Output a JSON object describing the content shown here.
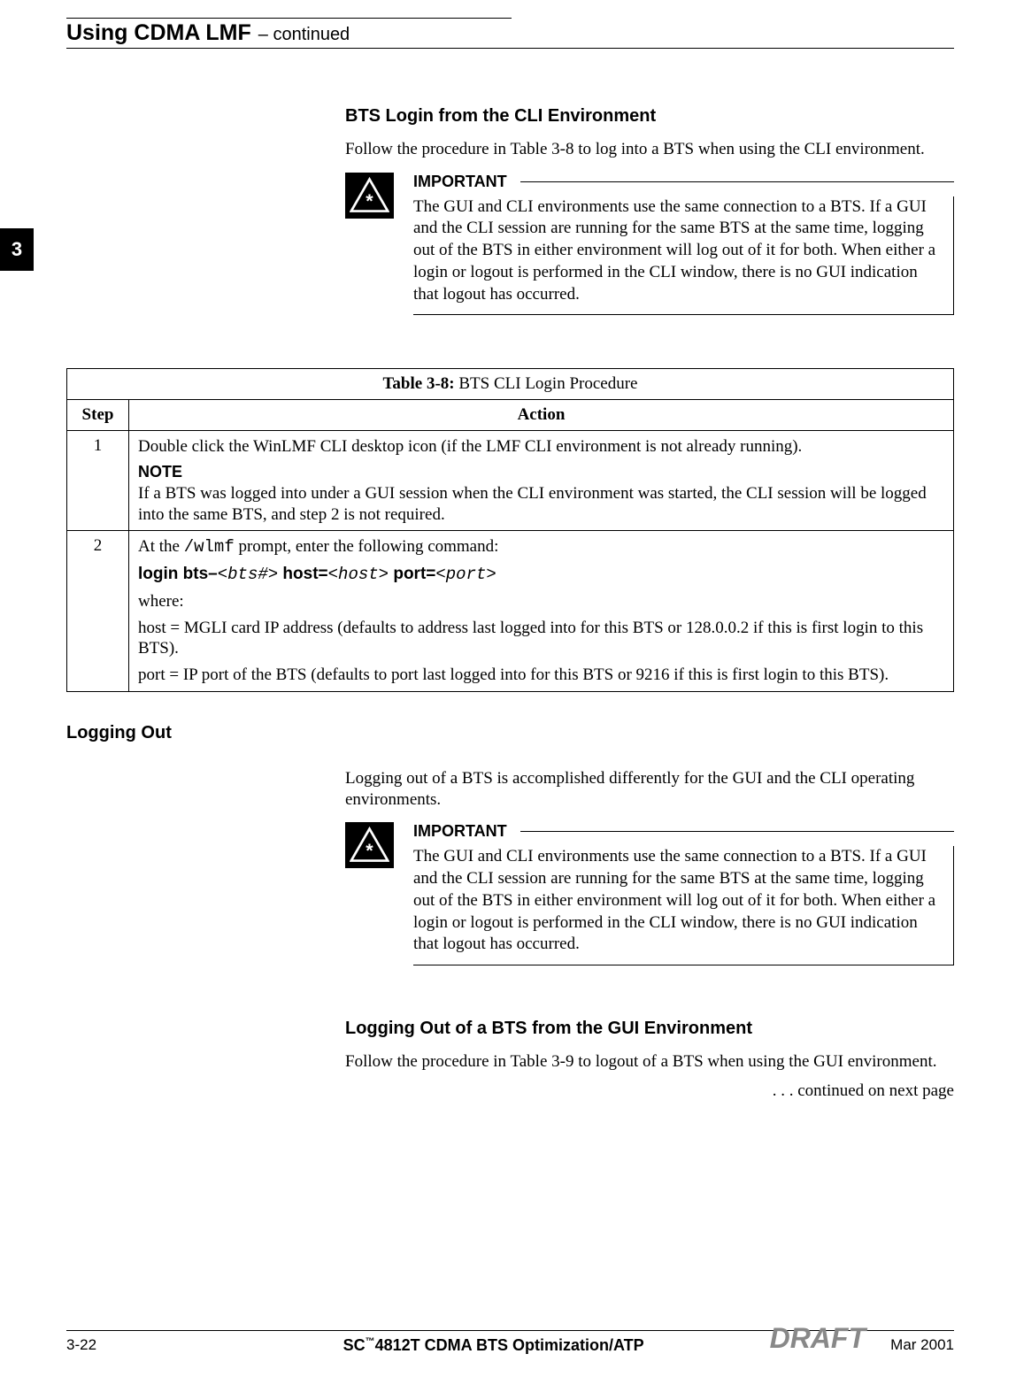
{
  "header": {
    "title": "Using CDMA LMF",
    "continued": " – continued"
  },
  "section_tab": "3",
  "s1": {
    "heading": "BTS Login from the CLI Environment",
    "para": "Follow the procedure in Table 3-8 to log into a BTS when using the CLI environment.",
    "important_label": "IMPORTANT",
    "important_text": "The GUI and CLI environments use the same connection to a BTS. If a GUI and the CLI session are running for the same BTS at the same time, logging out of the BTS in either environment will log out of it for both. When either a login or logout is performed in the CLI window, there is no GUI indication that logout has occurred."
  },
  "table": {
    "title_bold": "Table 3-8:",
    "title_rest": " BTS CLI Login Procedure",
    "col1": "Step",
    "col2": "Action",
    "row1": {
      "step": "1",
      "p1": "Double click the WinLMF CLI desktop icon (if the LMF CLI environment is not already running).",
      "note_label": "NOTE",
      "p2": "If a BTS was logged into under a GUI session when the CLI environment was started, the CLI session will be logged into the same BTS, and step 2 is not required."
    },
    "row2": {
      "step": "2",
      "p1a": "At the ",
      "p1b": "/wlmf",
      "p1c": " prompt, enter the following command:",
      "cmd_a": "login bts–",
      "cmd_b": "<bts#>",
      "cmd_c": "  host=",
      "cmd_d": "<host>",
      "cmd_e": "  port=",
      "cmd_f": "<port>",
      "p3": "where:",
      "p4": "host = MGLI card IP address (defaults to address last logged into for this BTS or 128.0.0.2 if this is first login to this BTS).",
      "p5": "port = IP port of the BTS (defaults to port last logged into for this BTS or 9216 if this is first login to this BTS)."
    }
  },
  "s2": {
    "side_heading": "Logging Out",
    "para": "Logging out of a BTS is accomplished differently for the GUI and the CLI operating environments.",
    "important_label": "IMPORTANT",
    "important_text": "The GUI and CLI environments use the same connection to a BTS. If a GUI and the CLI session are running for the same BTS at the same time, logging out of the BTS in either environment will log out of it for both. When either a login or logout is performed in the CLI window, there is no GUI indication that logout has occurred."
  },
  "s3": {
    "heading": "Logging Out of a BTS from the GUI Environment",
    "para": "Follow the procedure in Table 3-9 to logout of a BTS when using the GUI environment.",
    "continued": ". . . continued on next page"
  },
  "footer": {
    "left": "3-22",
    "center_a": "SC",
    "center_tm": "™",
    "center_b": "4812T CDMA BTS Optimization/ATP",
    "right": "Mar 2001",
    "draft": "DRAFT"
  }
}
